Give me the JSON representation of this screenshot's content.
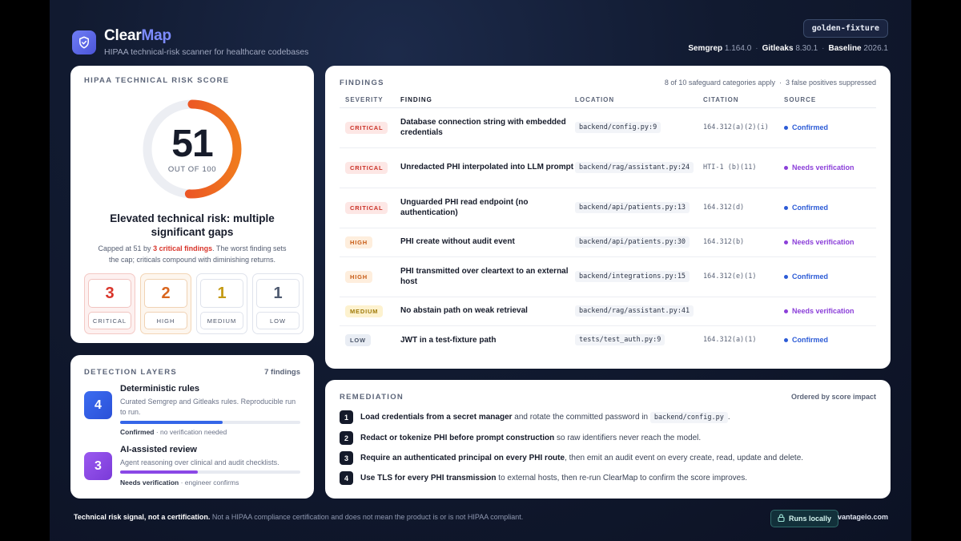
{
  "header": {
    "brand_part1": "Clear",
    "brand_part2": "Map",
    "subtitle": "HIPAA technical-risk scanner for healthcare codebases",
    "fixture": "golden-fixture",
    "versions": [
      {
        "name": "Semgrep",
        "version": "1.164.0"
      },
      {
        "name": "Gitleaks",
        "version": "8.30.1"
      },
      {
        "name": "Baseline",
        "version": "2026.1"
      }
    ]
  },
  "score": {
    "title": "HIPAA TECHNICAL RISK SCORE",
    "value": "51",
    "value_fraction": 0.51,
    "out_of": "OUT OF 100",
    "verdict": "Elevated technical risk: multiple significant gaps",
    "note_pre": "Capped at 51 by ",
    "note_crit": "3 critical findings",
    "note_post": ". The worst finding sets the cap; criticals compound with diminishing returns.",
    "counts": [
      {
        "count": "3",
        "label": "CRITICAL"
      },
      {
        "count": "2",
        "label": "HIGH"
      },
      {
        "count": "1",
        "label": "MEDIUM"
      },
      {
        "count": "1",
        "label": "LOW"
      }
    ]
  },
  "detection": {
    "title": "DETECTION LAYERS",
    "count": "7 findings",
    "layers": [
      {
        "badge": "4",
        "title": "Deterministic rules",
        "desc": "Curated Semgrep and Gitleaks rules. Reproducible run to run.",
        "fill_fraction": 0.57,
        "status_bold": "Confirmed",
        "status_rest": " · no verification needed"
      },
      {
        "badge": "3",
        "title": "AI-assisted review",
        "desc": "Agent reasoning over clinical and audit checklists.",
        "fill_fraction": 0.43,
        "status_bold": "Needs verification",
        "status_rest": " · engineer confirms"
      }
    ]
  },
  "findings": {
    "title": "FINDINGS",
    "meta_left": "8 of 10 safeguard categories apply",
    "meta_right": "3 false positives suppressed",
    "columns": [
      "SEVERITY",
      "FINDING",
      "LOCATION",
      "CITATION",
      "SOURCE"
    ],
    "rows": [
      {
        "severity": "CRITICAL",
        "finding": "Database connection string with embedded credentials",
        "location": "backend/config.py:9",
        "citation": "164.312(a)(2)(i)",
        "source": "Confirmed"
      },
      {
        "severity": "CRITICAL",
        "finding": "Unredacted PHI interpolated into LLM prompt",
        "location": "backend/rag/assistant.py:24",
        "citation": "HTI-1 (b)(11)",
        "source": "Needs verification"
      },
      {
        "severity": "CRITICAL",
        "finding": "Unguarded PHI read endpoint (no authentication)",
        "location": "backend/api/patients.py:13",
        "citation": "164.312(d)",
        "source": "Confirmed"
      },
      {
        "severity": "HIGH",
        "finding": "PHI create without audit event",
        "location": "backend/api/patients.py:30",
        "citation": "164.312(b)",
        "source": "Needs verification"
      },
      {
        "severity": "HIGH",
        "finding": "PHI transmitted over cleartext to an external host",
        "location": "backend/integrations.py:15",
        "citation": "164.312(e)(1)",
        "source": "Confirmed"
      },
      {
        "severity": "MEDIUM",
        "finding": "No abstain path on weak retrieval",
        "location": "backend/rag/assistant.py:41",
        "citation": "",
        "source": "Needs verification"
      },
      {
        "severity": "LOW",
        "finding": "JWT in a test-fixture path",
        "location": "tests/test_auth.py:9",
        "citation": "164.312(a)(1)",
        "source": "Confirmed"
      }
    ]
  },
  "remediation": {
    "title": "REMEDIATION",
    "meta": "Ordered by score impact",
    "steps": [
      {
        "num": "1",
        "bold": "Load credentials from a secret manager",
        "rest": " and rotate the committed password in ",
        "code": "backend/config.py",
        "tail": "."
      },
      {
        "num": "2",
        "bold": "Redact or tokenize PHI before prompt construction",
        "rest": " so raw identifiers never reach the model.",
        "code": "",
        "tail": ""
      },
      {
        "num": "3",
        "bold": "Require an authenticated principal on every PHI route",
        "rest": ", then emit an audit event on every create, read, update and delete.",
        "code": "",
        "tail": ""
      },
      {
        "num": "4",
        "bold": "Use TLS for every PHI transmission",
        "rest": " to external hosts, then re-run ClearMap to confirm the score improves.",
        "code": "",
        "tail": ""
      }
    ]
  },
  "footer": {
    "disclaimer_bold": "Technical risk signal, not a certification.",
    "disclaimer_rest": " Not a HIPAA compliance certification and does not mean the product is or is not HIPAA compliant.",
    "runs_locally": "Runs locally",
    "site": "vantageio.com"
  },
  "colors": {
    "critical": "#d9352b",
    "high": "#d9661e",
    "medium": "#c49a14",
    "confirmed": "#2c5bd6",
    "needs_verification": "#8b3fd9",
    "brand_accent": "#7d8cff"
  },
  "icons": {
    "logo": "shield-check-icon",
    "runs_locally": "lock-icon"
  }
}
